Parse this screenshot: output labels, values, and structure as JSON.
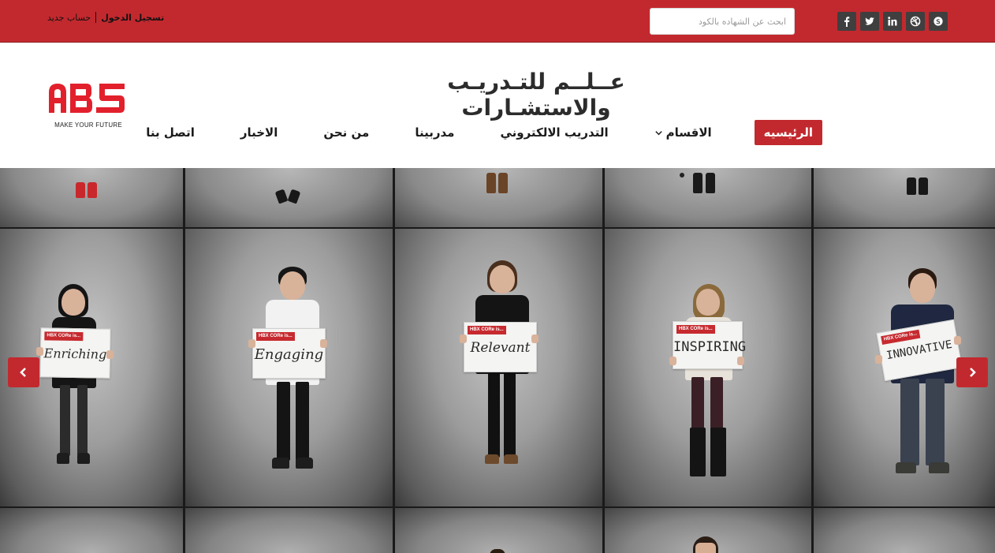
{
  "colors": {
    "brand_red": "#c2292e",
    "dark": "#3f3f3f",
    "text": "#1b1b1b"
  },
  "topbar": {
    "social": [
      {
        "icon": "facebook-icon"
      },
      {
        "icon": "twitter-icon"
      },
      {
        "icon": "linkedin-icon"
      },
      {
        "icon": "dribbble-icon"
      },
      {
        "icon": "skype-icon"
      }
    ],
    "search_placeholder": "ابحث عن الشهاده بالكود",
    "login_label": "تسجيل الدخول",
    "register_label": "حساب جديد"
  },
  "header": {
    "logo_text": "ABS",
    "logo_tagline": "MAKE YOUR FUTURE",
    "site_title": "عــلــم للتـدريـب والاستشـارات",
    "nav": [
      {
        "label": "الرئيسيه",
        "active": true
      },
      {
        "label": "الاقسام",
        "has_dropdown": true
      },
      {
        "label": "التدريب الالكتروني"
      },
      {
        "label": "مدربينا"
      },
      {
        "label": "من نحن"
      },
      {
        "label": "الاخبار"
      },
      {
        "label": "اتصل بنا"
      }
    ]
  },
  "hero": {
    "boards": [
      {
        "strip": "HBX CORe is...",
        "word": "Enriching"
      },
      {
        "strip": "HBX CORe is...",
        "word": "Engaging"
      },
      {
        "strip": "HBX CORe is...",
        "word": "Relevant"
      },
      {
        "strip": "HBX CORe is...",
        "word": "INSPIRING"
      },
      {
        "strip": "HBX CORe is...",
        "word": "INNOVATIVE"
      }
    ],
    "prev_icon": "chevron-left-icon",
    "next_icon": "chevron-right-icon"
  }
}
